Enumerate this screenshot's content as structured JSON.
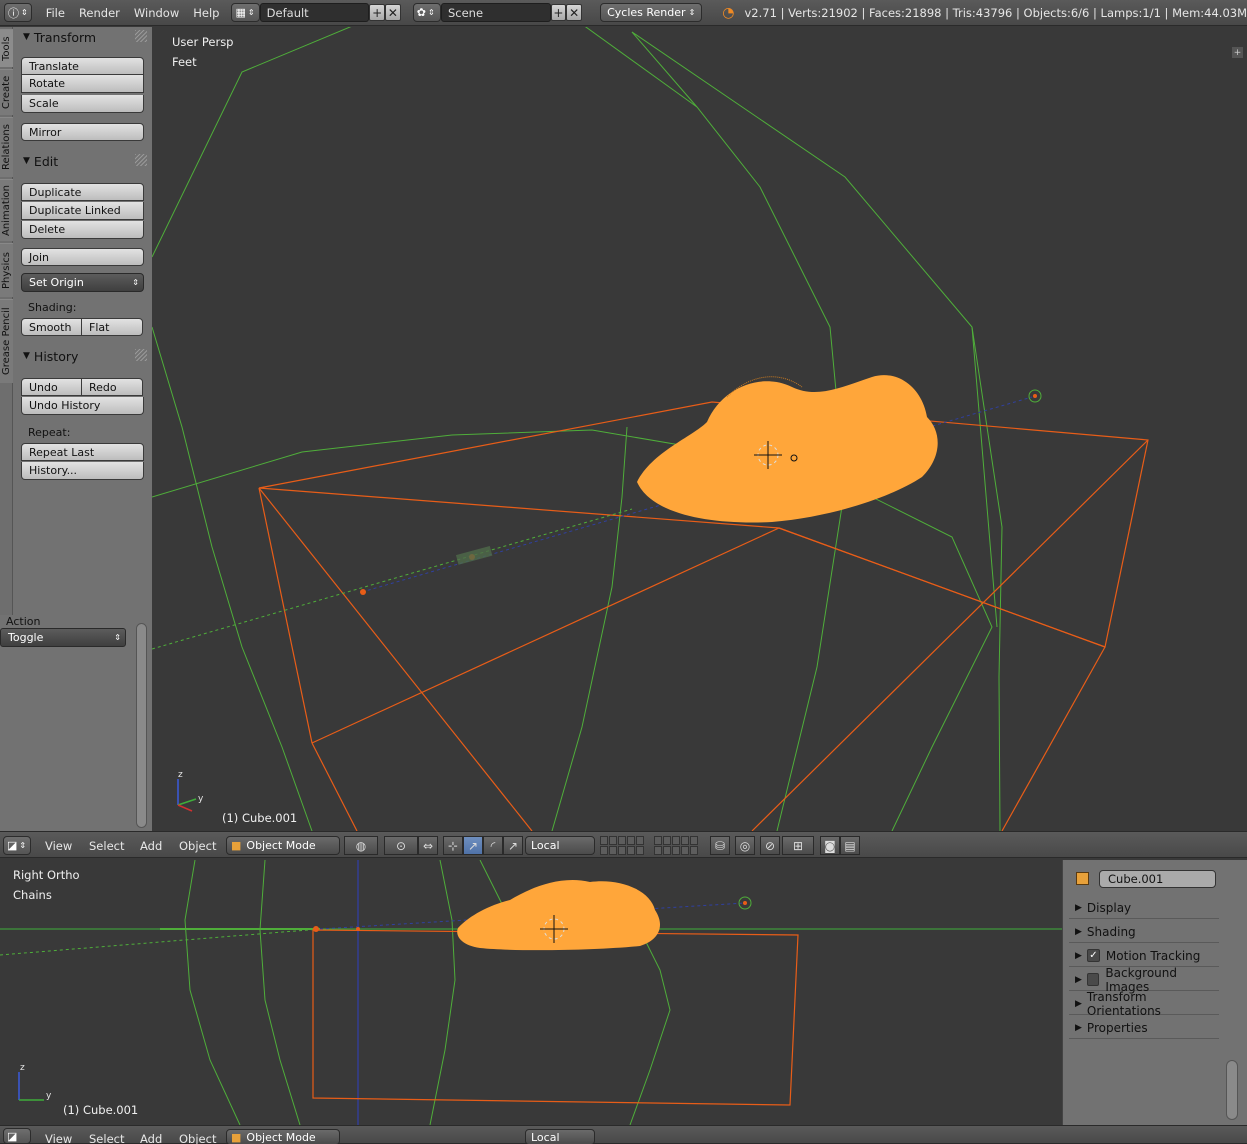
{
  "topbar": {
    "menus": [
      "File",
      "Render",
      "Window",
      "Help"
    ],
    "layout": "Default",
    "scene": "Scene",
    "engine": "Cycles Render",
    "stats": "v2.71 | Verts:21902 | Faces:21898 | Tris:43796 | Objects:6/6 | Lamps:1/1 | Mem:44.03M"
  },
  "tabs": [
    "Tools",
    "Create",
    "Relations",
    "Animation",
    "Physics",
    "Grease Pencil"
  ],
  "toolshelf": {
    "transform": {
      "title": "Transform",
      "translate": "Translate",
      "rotate": "Rotate",
      "scale": "Scale",
      "mirror": "Mirror"
    },
    "edit": {
      "title": "Edit",
      "duplicate": "Duplicate",
      "duplicate_linked": "Duplicate Linked",
      "delete": "Delete",
      "join": "Join",
      "set_origin": "Set Origin",
      "shading_label": "Shading:",
      "smooth": "Smooth",
      "flat": "Flat"
    },
    "history": {
      "title": "History",
      "undo": "Undo",
      "redo": "Redo",
      "undo_history": "Undo History",
      "repeat_label": "Repeat:",
      "repeat_last": "Repeat Last",
      "history": "History..."
    }
  },
  "action": {
    "label": "Action",
    "value": "Toggle"
  },
  "viewport_top": {
    "view": "User Persp",
    "units": "Feet",
    "object": "(1) Cube.001"
  },
  "viewport_bottom": {
    "view": "Right Ortho",
    "sub": "Chains",
    "object": "(1) Cube.001"
  },
  "header": {
    "menus": [
      "View",
      "Select",
      "Add",
      "Object"
    ],
    "mode": "Object Mode",
    "orientation": "Local"
  },
  "properties": {
    "object_name": "Cube.001",
    "rows": [
      {
        "label": "Display",
        "check": null
      },
      {
        "label": "Shading",
        "check": null
      },
      {
        "label": "Motion Tracking",
        "check": true
      },
      {
        "label": "Background Images",
        "check": false
      },
      {
        "label": "Transform Orientations",
        "check": null
      },
      {
        "label": "Properties",
        "check": null
      }
    ]
  },
  "colors": {
    "wire": "#4fae3a",
    "selected": "#e85d18",
    "mesh": "#ffa63a",
    "background": "#393939"
  }
}
